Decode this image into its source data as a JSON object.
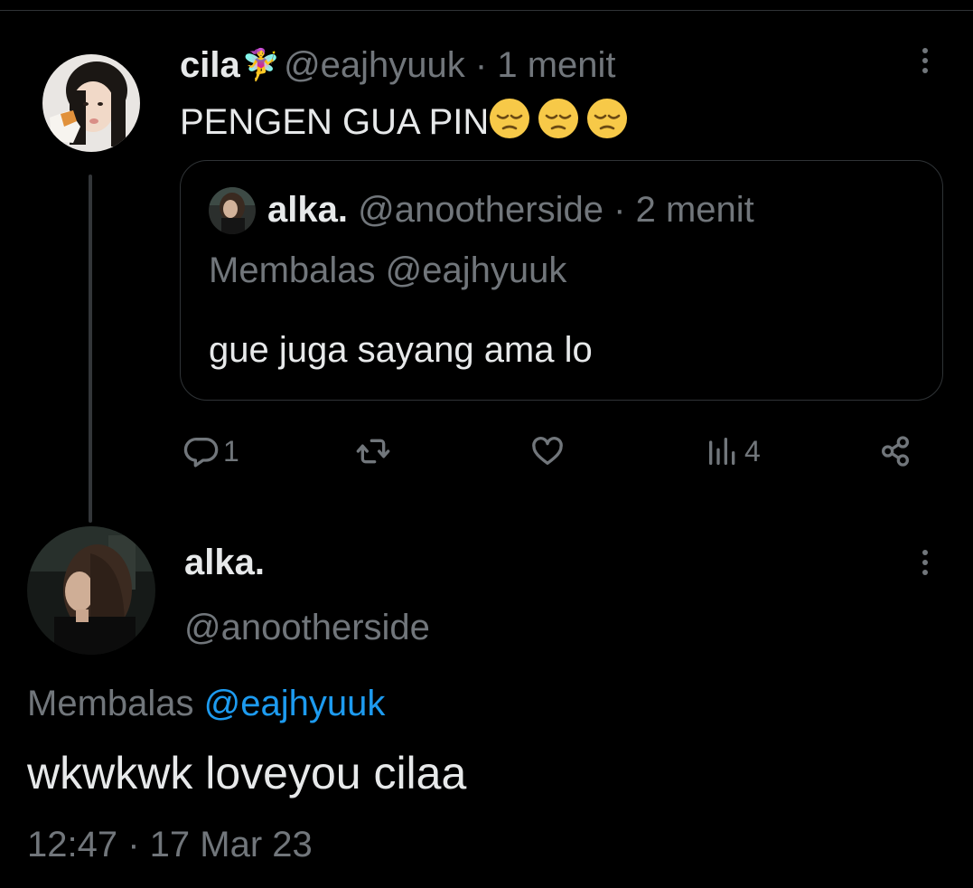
{
  "tweet1": {
    "display_name": "cila",
    "name_emoji": "🧚‍♀️",
    "handle": "@eajhyuuk",
    "separator": "·",
    "time": "1 menit",
    "text": "PENGEN GUA PIN",
    "text_emoji_name": "pensive-face",
    "text_emoji_count": 3,
    "avatar": "user-avatar-photo",
    "more_icon": "more-options-icon"
  },
  "quoted": {
    "display_name": "alka.",
    "handle": "@anootherside",
    "separator": "·",
    "time": "2 menit",
    "reply_context": "Membalas @eajhyuuk",
    "text": "gue juga sayang ama lo"
  },
  "actions": {
    "reply": {
      "icon": "reply-icon",
      "count": "1"
    },
    "retweet": {
      "icon": "retweet-icon",
      "count": ""
    },
    "like": {
      "icon": "heart-icon",
      "count": ""
    },
    "views": {
      "icon": "views-icon",
      "count": "4"
    },
    "share": {
      "icon": "share-icon"
    }
  },
  "tweet2": {
    "display_name": "alka.",
    "handle": "@anootherside",
    "reply_prefix": "Membalas",
    "reply_to": "@eajhyuuk",
    "text": "wkwkwk loveyou cilaa",
    "timestamp": "12:47 · 17 Mar 23",
    "more_icon": "more-options-icon"
  },
  "colors": {
    "background": "#000000",
    "text_primary": "#e7e9ea",
    "text_secondary": "#71767b",
    "link": "#1d9bf0",
    "border": "#2f3336"
  }
}
